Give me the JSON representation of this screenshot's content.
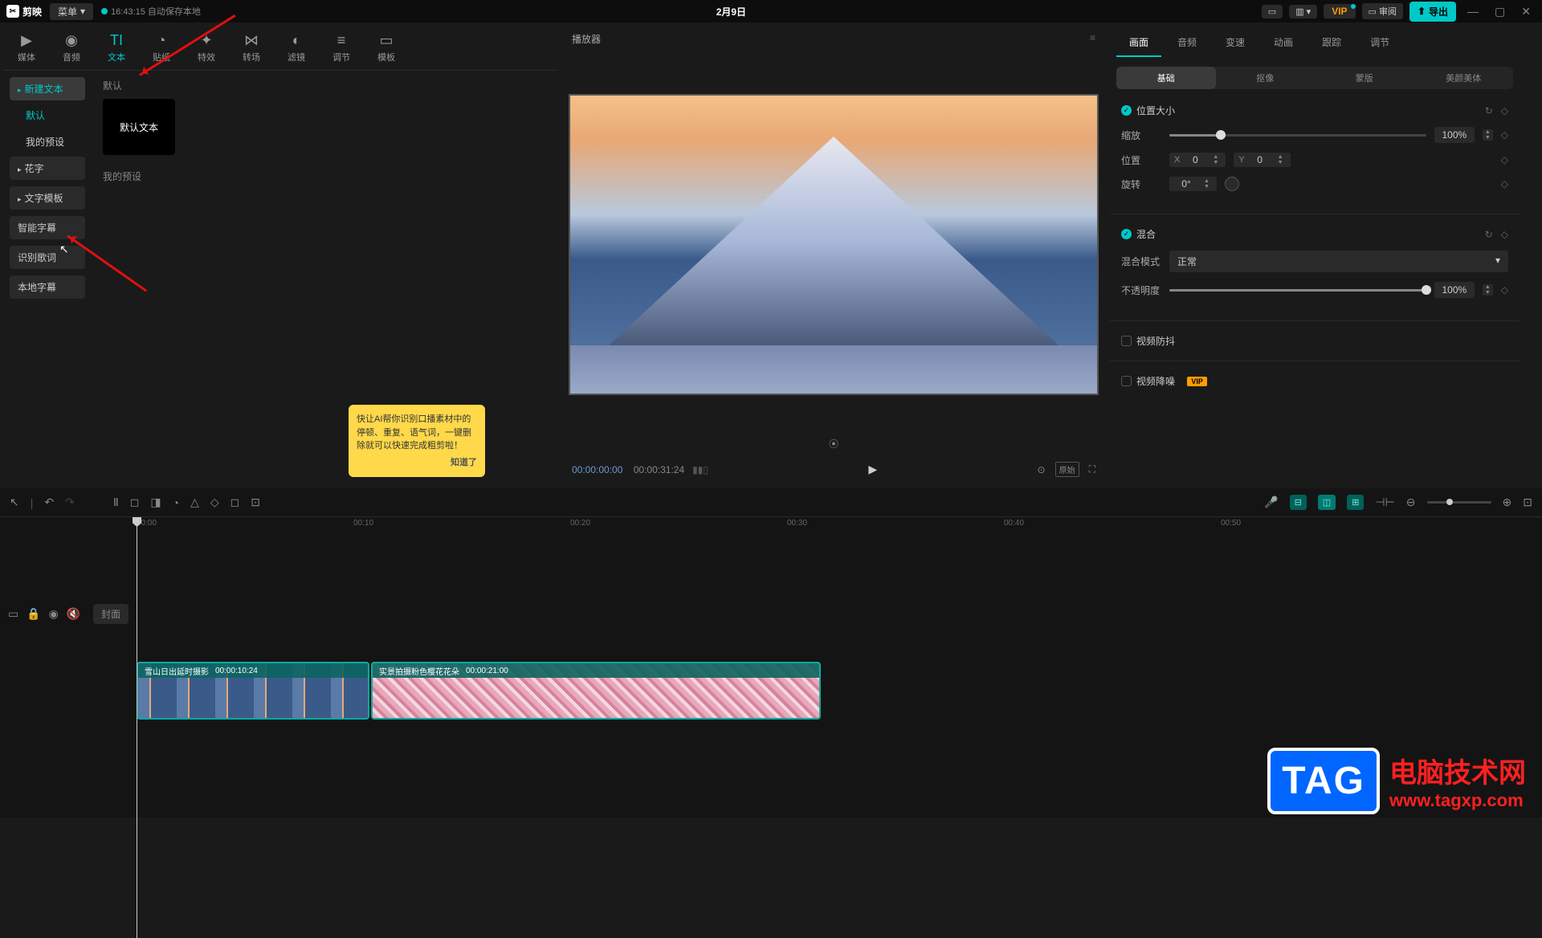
{
  "topbar": {
    "app_name": "剪映",
    "menu": "菜单",
    "autosave": "16:43:15 自动保存本地",
    "title": "2月9日",
    "vip": "VIP",
    "review": "审阅",
    "export": "导出"
  },
  "tool_tabs": [
    {
      "icon": "▶",
      "label": "媒体"
    },
    {
      "icon": "◉",
      "label": "音频"
    },
    {
      "icon": "TI",
      "label": "文本"
    },
    {
      "icon": "◔",
      "label": "贴纸"
    },
    {
      "icon": "✦",
      "label": "特效"
    },
    {
      "icon": "⋈",
      "label": "转场"
    },
    {
      "icon": "◐",
      "label": "滤镜"
    },
    {
      "icon": "≡",
      "label": "调节"
    },
    {
      "icon": "▭",
      "label": "模板"
    }
  ],
  "sidebar": {
    "new_text": "新建文本",
    "default": "默认",
    "my_preset": "我的预设",
    "flower": "花字",
    "template": "文字模板",
    "smart_sub": "智能字幕",
    "lyrics": "识别歌词",
    "local_sub": "本地字幕"
  },
  "content": {
    "section1": "默认",
    "default_text_card": "默认文本",
    "section2": "我的预设"
  },
  "tip": {
    "body": "快让AI帮你识别口播素材中的停顿、重复、语气词，一键删除就可以快速完成粗剪啦！",
    "ok": "知道了"
  },
  "preview": {
    "title": "播放器",
    "current_time": "00:00:00:00",
    "total_time": "00:00:31:24",
    "ratio": "原始"
  },
  "right_tabs": [
    "画面",
    "音频",
    "变速",
    "动画",
    "跟踪",
    "调节"
  ],
  "right_subtabs": [
    "基础",
    "抠像",
    "蒙版",
    "美颜美体"
  ],
  "props": {
    "pos_size": "位置大小",
    "scale": "缩放",
    "scale_val": "100%",
    "position": "位置",
    "x_label": "X",
    "x_val": "0",
    "y_label": "Y",
    "y_val": "0",
    "rotation": "旋转",
    "rot_val": "0°",
    "blend": "混合",
    "blend_mode": "混合模式",
    "blend_mode_val": "正常",
    "opacity": "不透明度",
    "opacity_val": "100%",
    "stabilize": "视频防抖",
    "denoise": "视频降噪",
    "vip": "VIP"
  },
  "timeline": {
    "cover": "封面",
    "marks": [
      "00:00",
      "00:10",
      "00:20",
      "00:30",
      "00:40",
      "00:50"
    ],
    "clip1_name": "雪山日出延时摄影",
    "clip1_dur": "00:00:10:24",
    "clip2_name": "实景拍摄粉色樱花花朵",
    "clip2_dur": "00:00:21:00"
  },
  "watermark": {
    "tag": "TAG",
    "line1": "电脑技术网",
    "line2": "www.tagxp.com"
  }
}
